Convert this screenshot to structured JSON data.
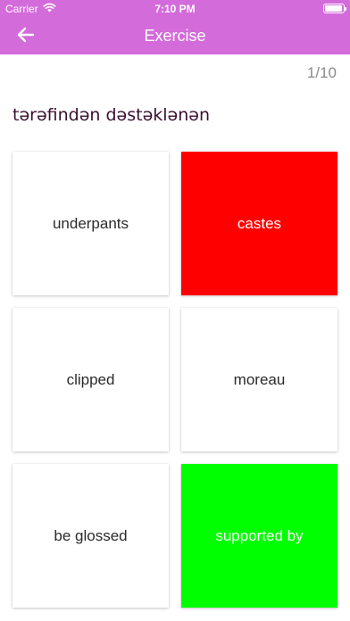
{
  "status_bar": {
    "carrier": "Carrier",
    "time": "7:10 PM",
    "icons": [
      "wifi-icon",
      "battery-icon"
    ]
  },
  "nav": {
    "title": "Exercise",
    "back_icon": "arrow-left-icon",
    "background_color": "#d36bdb"
  },
  "progress": "1/10",
  "question": "tərəfindən dəstəklənən",
  "options": [
    {
      "label": "underpants",
      "state": "default"
    },
    {
      "label": "castes",
      "state": "wrong",
      "color": "#ff0000"
    },
    {
      "label": "clipped",
      "state": "default"
    },
    {
      "label": "moreau",
      "state": "default"
    },
    {
      "label": "be glossed",
      "state": "default"
    },
    {
      "label": "supported by",
      "state": "correct",
      "color": "#00ff00"
    }
  ]
}
